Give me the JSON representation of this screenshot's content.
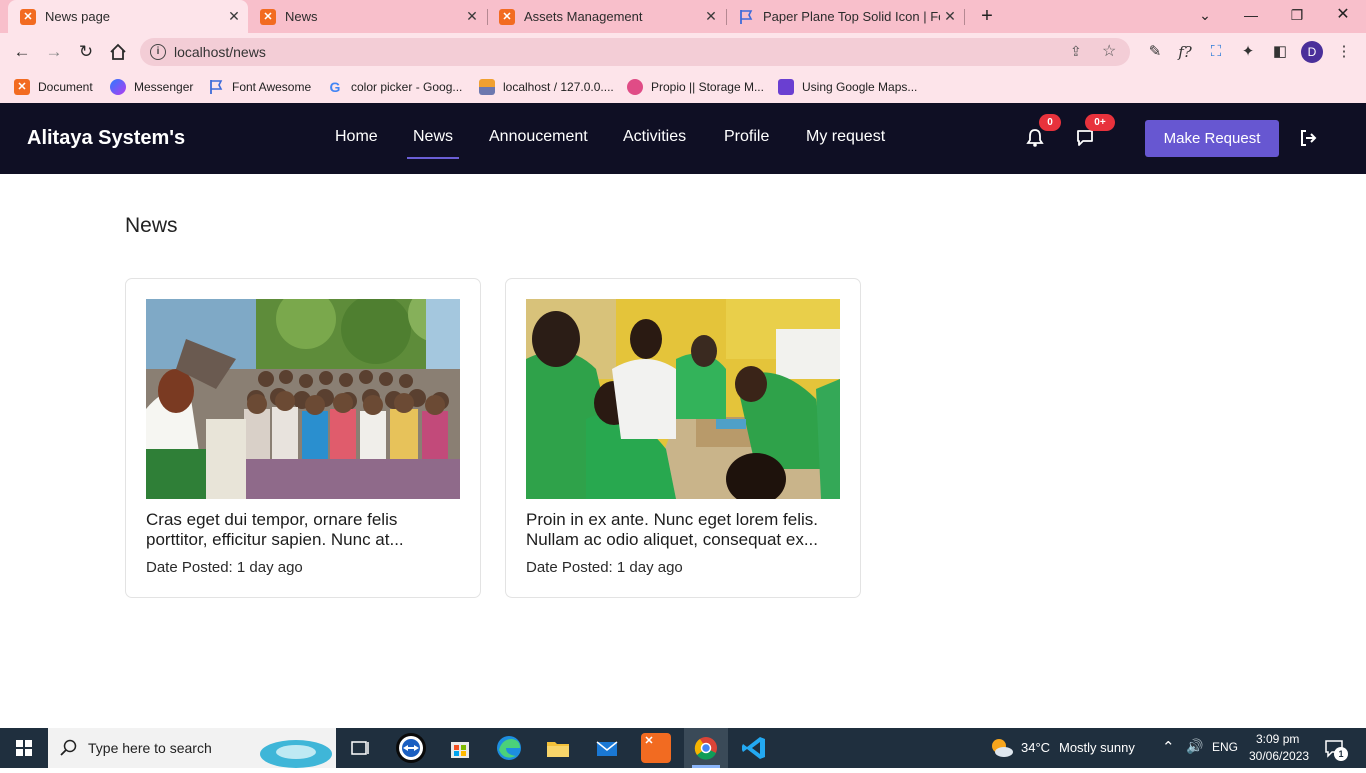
{
  "browser": {
    "tabs": [
      {
        "title": "News page",
        "icon": "xampp-icon",
        "active": true
      },
      {
        "title": "News",
        "icon": "xampp-icon",
        "active": false
      },
      {
        "title": "Assets Management",
        "icon": "xampp-icon",
        "active": false
      },
      {
        "title": "Paper Plane Top Solid Icon | Font",
        "icon": "font-awesome-flag-icon",
        "active": false
      }
    ],
    "new_tab_glyph": "+",
    "url": "localhost/news",
    "profile_initial": "D",
    "bookmarks": [
      {
        "label": "Document",
        "icon": "xampp-icon"
      },
      {
        "label": "Messenger",
        "icon": "messenger-icon"
      },
      {
        "label": "Font Awesome",
        "icon": "font-awesome-flag-icon"
      },
      {
        "label": "color picker - Goog...",
        "icon": "google-icon"
      },
      {
        "label": "localhost / 127.0.0....",
        "icon": "phpmyadmin-icon"
      },
      {
        "label": "Propio || Storage M...",
        "icon": "dribbble-icon"
      },
      {
        "label": "Using Google Maps...",
        "icon": "bookmark-icon"
      }
    ]
  },
  "app": {
    "brand": "Alitaya System's",
    "nav": [
      {
        "label": "Home",
        "active": false
      },
      {
        "label": "News",
        "active": true
      },
      {
        "label": "Annoucement",
        "active": false
      },
      {
        "label": "Activities",
        "active": false
      },
      {
        "label": "Profile",
        "active": false
      },
      {
        "label": "My request",
        "active": false
      }
    ],
    "notifications_count": "0",
    "messages_count": "0+",
    "make_request_label": "Make Request",
    "accent": "#6757d1"
  },
  "main": {
    "heading": "News",
    "cards": [
      {
        "title": "Cras eget dui tempor, ornare felis porttitor, efficitur sapien. Nunc at...",
        "date": "Date Posted: 1 day ago"
      },
      {
        "title": "Proin in ex ante. Nunc eget lorem felis. Nullam ac odio aliquet, consequat ex...",
        "date": "Date Posted: 1 day ago"
      }
    ]
  },
  "taskbar": {
    "search_placeholder": "Type here to search",
    "weather_temp": "34°C",
    "weather_text": "Mostly sunny",
    "language": "ENG",
    "time": "3:09 pm",
    "date": "30/06/2023",
    "notification_count": "1"
  }
}
